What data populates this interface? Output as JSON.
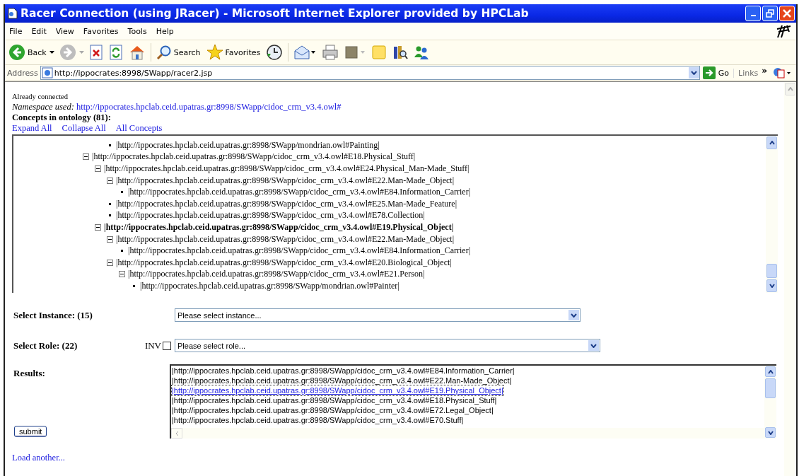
{
  "window": {
    "title": "Racer Connection (using JRacer) - Microsoft Internet Explorer provided by HPCLab"
  },
  "menu": [
    "File",
    "Edit",
    "View",
    "Favorites",
    "Tools",
    "Help"
  ],
  "toolbar": [
    {
      "kind": "back",
      "label": "Back"
    },
    {
      "kind": "forward"
    },
    {
      "kind": "stop"
    },
    {
      "kind": "refresh"
    },
    {
      "kind": "home"
    },
    {
      "kind": "search",
      "label": "Search"
    },
    {
      "kind": "favorites",
      "label": "Favorites"
    },
    {
      "kind": "history"
    },
    {
      "kind": "mail"
    },
    {
      "kind": "print"
    },
    {
      "kind": "edit"
    },
    {
      "kind": "note"
    },
    {
      "kind": "research"
    },
    {
      "kind": "messenger"
    }
  ],
  "address": {
    "label": "Address",
    "value": "http://ippocrates:8998/SWapp/racer2.jsp",
    "go": "Go",
    "links": "Links",
    "more": "»"
  },
  "page": {
    "status": "Already connected",
    "namespace_label": "Namespace used:",
    "namespace": "http://ippocrates.hpclab.ceid.upatras.gr:8998/SWapp/cidoc_crm_v3.4.owl#",
    "concepts_heading": "Concepts in ontology (81):",
    "links": [
      "Expand All",
      "Collapse All",
      "All Concepts"
    ],
    "tree": [
      {
        "children": [
          {
            "children": [
              {
                "kind": "leaf",
                "label": "|http://ippocrates.hpclab.ceid.upatras.gr:8998/SWapp/mondrian.owl#Painting|",
                "selected": false
              }
            ]
          }
        ]
      },
      {
        "kind": "branch",
        "expanded": true,
        "selected": false,
        "label": "|http://ippocrates.hpclab.ceid.upatras.gr:8998/SWapp/cidoc_crm_v3.4.owl#E18.Physical_Stuff|",
        "children": [
          {
            "kind": "branch",
            "expanded": true,
            "selected": false,
            "label": "|http://ippocrates.hpclab.ceid.upatras.gr:8998/SWapp/cidoc_crm_v3.4.owl#E24.Physical_Man-Made_Stuff|",
            "children": [
              {
                "kind": "branch",
                "expanded": true,
                "selected": false,
                "label": "|http://ippocrates.hpclab.ceid.upatras.gr:8998/SWapp/cidoc_crm_v3.4.owl#E22.Man-Made_Object|",
                "children": [
                  {
                    "kind": "leaf",
                    "selected": false,
                    "label": "|http://ippocrates.hpclab.ceid.upatras.gr:8998/SWapp/cidoc_crm_v3.4.owl#E84.Information_Carrier|"
                  }
                ]
              },
              {
                "kind": "leaf",
                "selected": false,
                "label": "|http://ippocrates.hpclab.ceid.upatras.gr:8998/SWapp/cidoc_crm_v3.4.owl#E25.Man-Made_Feature|"
              },
              {
                "kind": "leaf",
                "selected": false,
                "label": "|http://ippocrates.hpclab.ceid.upatras.gr:8998/SWapp/cidoc_crm_v3.4.owl#E78.Collection|"
              }
            ]
          },
          {
            "kind": "branch",
            "expanded": true,
            "selected": true,
            "label": "|http://ippocrates.hpclab.ceid.upatras.gr:8998/SWapp/cidoc_crm_v3.4.owl#E19.Physical_Object|",
            "children": [
              {
                "kind": "branch",
                "expanded": true,
                "selected": false,
                "label": "|http://ippocrates.hpclab.ceid.upatras.gr:8998/SWapp/cidoc_crm_v3.4.owl#E22.Man-Made_Object|",
                "children": [
                  {
                    "kind": "leaf",
                    "selected": false,
                    "label": "|http://ippocrates.hpclab.ceid.upatras.gr:8998/SWapp/cidoc_crm_v3.4.owl#E84.Information_Carrier|"
                  }
                ]
              },
              {
                "kind": "branch",
                "expanded": true,
                "selected": false,
                "label": "|http://ippocrates.hpclab.ceid.upatras.gr:8998/SWapp/cidoc_crm_v3.4.owl#E20.Biological_Object|",
                "children": [
                  {
                    "kind": "branch",
                    "expanded": true,
                    "selected": false,
                    "label": "|http://ippocrates.hpclab.ceid.upatras.gr:8998/SWapp/cidoc_crm_v3.4.owl#E21.Person|",
                    "children": [
                      {
                        "kind": "leaf",
                        "selected": false,
                        "label": "|http://ippocrates.hpclab.ceid.upatras.gr:8998/SWapp/mondrian.owl#Painter|"
                      }
                    ]
                  }
                ]
              }
            ]
          }
        ]
      }
    ],
    "instance": {
      "label": "Select Instance: (15)",
      "placeholder": "Please select instance..."
    },
    "role": {
      "label": "Select Role: (22)",
      "inv_label": "INV",
      "inv_checked": false,
      "placeholder": "Please select role..."
    },
    "results": {
      "label": "Results:",
      "items": [
        {
          "text": "|http://ippocrates.hpclab.ceid.upatras.gr:8998/SWapp/cidoc_crm_v3.4.owl#E84.Information_Carrier|",
          "selected": false
        },
        {
          "text": "|http://ippocrates.hpclab.ceid.upatras.gr:8998/SWapp/cidoc_crm_v3.4.owl#E22.Man-Made_Object|",
          "selected": false
        },
        {
          "text": "|http://ippocrates.hpclab.ceid.upatras.gr:8998/SWapp/cidoc_crm_v3.4.owl#E19.Physical_Object|",
          "selected": true
        },
        {
          "text": "|http://ippocrates.hpclab.ceid.upatras.gr:8998/SWapp/cidoc_crm_v3.4.owl#E18.Physical_Stuff|",
          "selected": false
        },
        {
          "text": "|http://ippocrates.hpclab.ceid.upatras.gr:8998/SWapp/cidoc_crm_v3.4.owl#E72.Legal_Object|",
          "selected": false
        },
        {
          "text": "|http://ippocrates.hpclab.ceid.upatras.gr:8998/SWapp/cidoc_crm_v3.4.owl#E70.Stuff|",
          "selected": false
        }
      ]
    },
    "submit": "submit",
    "load_link": "Load another..."
  }
}
